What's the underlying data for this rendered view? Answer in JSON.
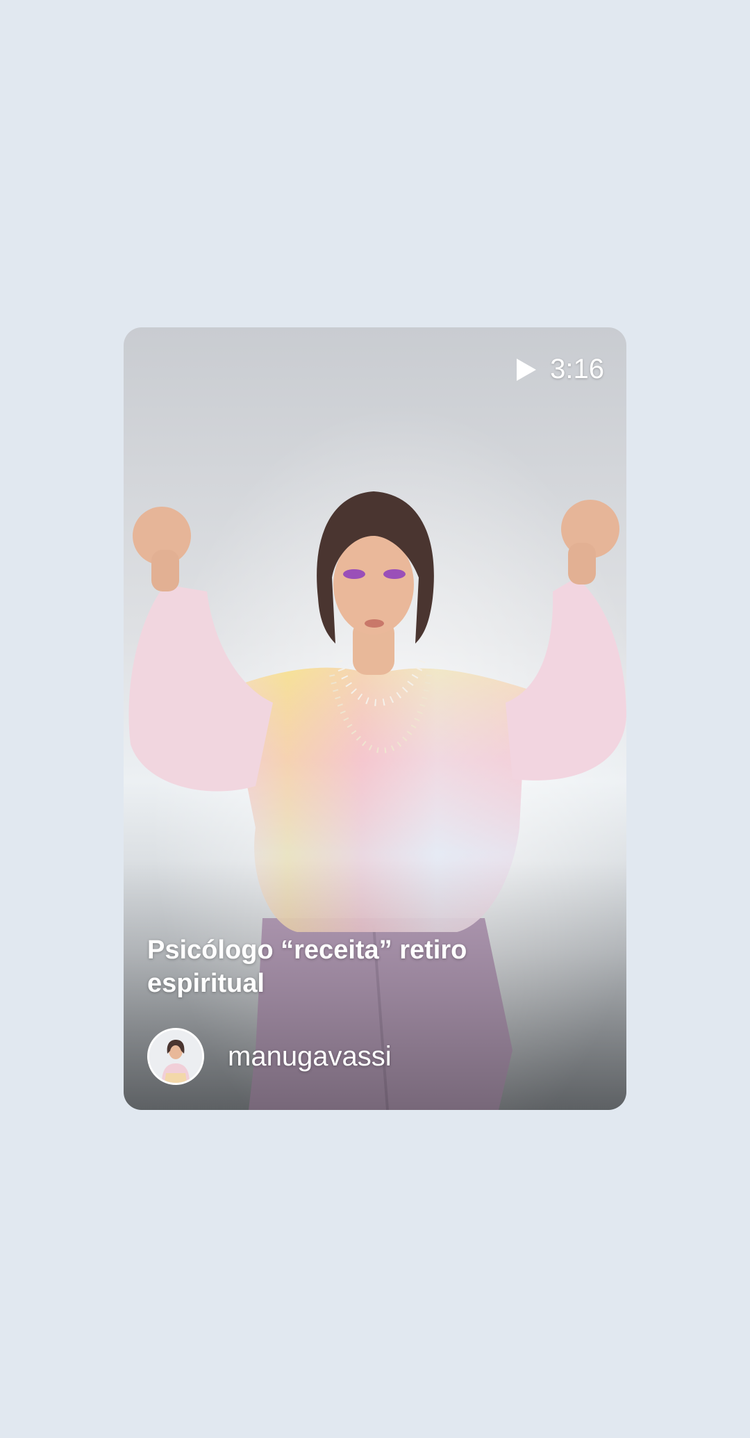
{
  "card": {
    "duration": "3:16",
    "title": "Psicólogo “receita” retiro espiritual",
    "author": {
      "username": "manugavassi"
    },
    "icons": {
      "play": "play-icon",
      "avatar": "user-avatar"
    }
  },
  "colors": {
    "background": "#e1e8f0",
    "text_on_card": "#ffffff"
  }
}
